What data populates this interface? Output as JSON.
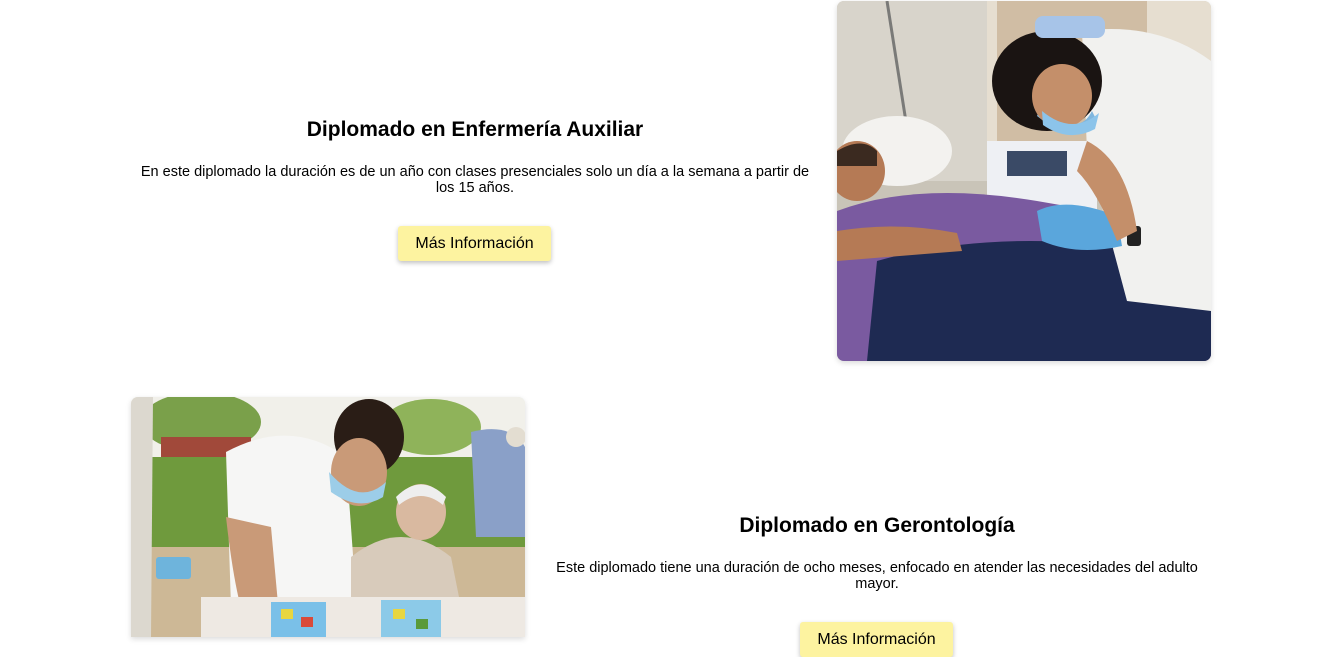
{
  "section1": {
    "title": "Diplomado en Enfermería Auxiliar",
    "description": "En este diplomado la duración es de un año con clases presenciales solo un día a la semana a partir de los 15 años.",
    "button_label": "Más Información",
    "image_subject": "nurse-photo"
  },
  "section2": {
    "title": "Diplomado en Gerontología",
    "description": "Este diplomado tiene una duración de ocho meses, enfocado en atender las necesidades del adulto mayor.",
    "button_label": "Más Información",
    "image_subject": "elderly-care-photo"
  },
  "colors": {
    "button_bg": "#fdf3a0",
    "page_bg": "#ffffff",
    "text": "#000000"
  }
}
